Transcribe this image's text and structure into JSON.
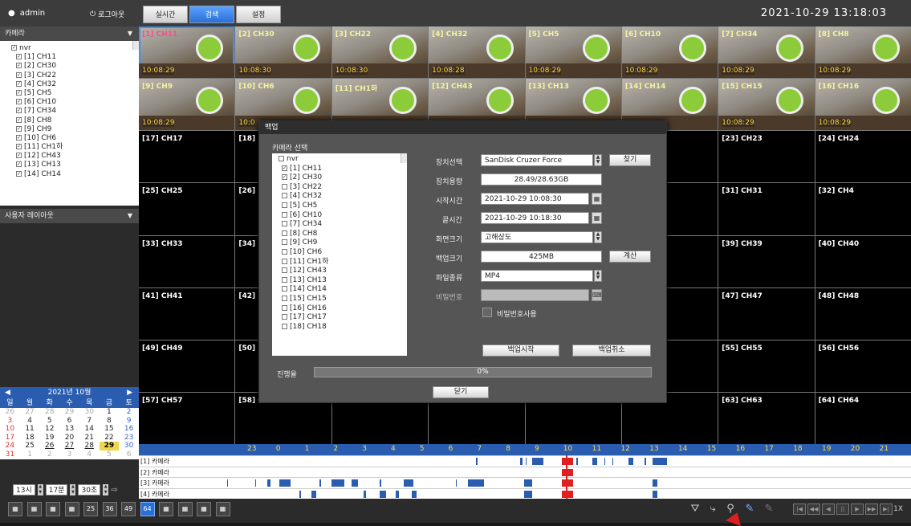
{
  "header": {
    "user": "admin",
    "logout_label": "로그아웃",
    "tabs": [
      {
        "label": "실시간",
        "active": false
      },
      {
        "label": "검색",
        "active": true
      },
      {
        "label": "설정",
        "active": false
      }
    ],
    "datetime": "2021-10-29 13:18:03"
  },
  "left_panel": {
    "camera_header": "카메라",
    "camera_root": "nvr",
    "cameras": [
      "[1] CH11",
      "[2] CH30",
      "[3] CH22",
      "[4] CH32",
      "[5] CH5",
      "[6] CH10",
      "[7] CH34",
      "[8] CH8",
      "[9] CH9",
      "[10] CH6",
      "[11] CH1하",
      "[12] CH43",
      "[13] CH13",
      "[14] CH14"
    ],
    "layout_header": "사용자 레이아웃",
    "calendar": {
      "month_label": "2021년 10월",
      "weekdays": [
        "일",
        "월",
        "화",
        "수",
        "목",
        "금",
        "토"
      ],
      "rows": [
        [
          "26",
          "27",
          "28",
          "29",
          "30",
          "1",
          "2"
        ],
        [
          "3",
          "4",
          "5",
          "6",
          "7",
          "8",
          "9"
        ],
        [
          "10",
          "11",
          "12",
          "13",
          "14",
          "15",
          "16"
        ],
        [
          "17",
          "18",
          "19",
          "20",
          "21",
          "22",
          "23"
        ],
        [
          "24",
          "25",
          "26",
          "27",
          "28",
          "29",
          "30"
        ],
        [
          "31",
          "1",
          "2",
          "3",
          "4",
          "5",
          "6"
        ]
      ],
      "selected_day": "29"
    },
    "time_controls": {
      "hour": "13시",
      "minute": "17분",
      "interval": "30초"
    }
  },
  "grid": {
    "cells": [
      {
        "label": "[1] CH11",
        "ts": "10:08:29",
        "live": true,
        "selected": true
      },
      {
        "label": "[2] CH30",
        "ts": "10:08:30",
        "live": true
      },
      {
        "label": "[3] CH22",
        "ts": "10:08:30",
        "live": true
      },
      {
        "label": "[4] CH32",
        "ts": "10:08:28",
        "live": true
      },
      {
        "label": "[5] CH5",
        "ts": "10:08:29",
        "live": true
      },
      {
        "label": "[6] CH10",
        "ts": "10:08:29",
        "live": true
      },
      {
        "label": "[7] CH34",
        "ts": "10:08:29",
        "live": true
      },
      {
        "label": "[8] CH8",
        "ts": "10:08:29",
        "live": true
      },
      {
        "label": "[9] CH9",
        "ts": "10:08:29",
        "live": true
      },
      {
        "label": "[10] CH6",
        "ts": "10:0",
        "live": true
      },
      {
        "label": "[11] CH1하",
        "ts": "",
        "live": true
      },
      {
        "label": "[12] CH43",
        "ts": "",
        "live": true
      },
      {
        "label": "[13] CH13",
        "ts": "",
        "live": true
      },
      {
        "label": "[14] CH14",
        "ts": "",
        "live": true
      },
      {
        "label": "[15] CH15",
        "ts": "10:08:29",
        "live": true
      },
      {
        "label": "[16] CH16",
        "ts": "10:08:29",
        "live": true
      },
      {
        "label": "[17] CH17"
      },
      {
        "label": "[18]"
      },
      {
        "label": ""
      },
      {
        "label": ""
      },
      {
        "label": ""
      },
      {
        "label": ""
      },
      {
        "label": "[23] CH23"
      },
      {
        "label": "[24] CH24"
      },
      {
        "label": "[25] CH25"
      },
      {
        "label": "[26]"
      },
      {
        "label": ""
      },
      {
        "label": ""
      },
      {
        "label": ""
      },
      {
        "label": ""
      },
      {
        "label": "[31] CH31"
      },
      {
        "label": "[32] CH4"
      },
      {
        "label": "[33] CH33"
      },
      {
        "label": "[34]"
      },
      {
        "label": ""
      },
      {
        "label": ""
      },
      {
        "label": ""
      },
      {
        "label": "7"
      },
      {
        "label": "[39] CH39"
      },
      {
        "label": "[40] CH40"
      },
      {
        "label": "[41] CH41"
      },
      {
        "label": "[42]"
      },
      {
        "label": ""
      },
      {
        "label": ""
      },
      {
        "label": ""
      },
      {
        "label": "5"
      },
      {
        "label": "[47] CH47"
      },
      {
        "label": "[48] CH48"
      },
      {
        "label": "[49] CH49"
      },
      {
        "label": "[50]"
      },
      {
        "label": ""
      },
      {
        "label": ""
      },
      {
        "label": ""
      },
      {
        "label": "4"
      },
      {
        "label": "[55] CH55"
      },
      {
        "label": "[56] CH56"
      },
      {
        "label": "[57] CH57"
      },
      {
        "label": "[58] CH58"
      },
      {
        "label": "[59] CH59"
      },
      {
        "label": "[60] CH60"
      },
      {
        "label": "[61] CH61"
      },
      {
        "label": "[62] CH62"
      },
      {
        "label": "[63] CH63"
      },
      {
        "label": "[64] CH64"
      }
    ]
  },
  "timeline": {
    "hours": [
      "23",
      "0",
      "1",
      "2",
      "3",
      "4",
      "5",
      "6",
      "7",
      "8",
      "9",
      "10",
      "11",
      "12",
      "13",
      "14",
      "15",
      "16",
      "17",
      "18",
      "19",
      "20",
      "21"
    ],
    "rows": [
      "[1] 카메라",
      "[2] 카메라",
      "[3] 카메라",
      "[4] 카메라"
    ]
  },
  "bottom_bar": {
    "layout_buttons": [
      "",
      "",
      "",
      "",
      "25",
      "36",
      "49",
      "64",
      "",
      "",
      "",
      ""
    ],
    "active_layout": "64",
    "speed": "1X"
  },
  "backup_dialog": {
    "title": "백업",
    "camera_select_label": "카메라 선택",
    "root": "nvr",
    "cameras": [
      {
        "label": "[1] CH11",
        "checked": true
      },
      {
        "label": "[2] CH30",
        "checked": true
      },
      {
        "label": "[3] CH22",
        "checked": false
      },
      {
        "label": "[4] CH32",
        "checked": false
      },
      {
        "label": "[5] CH5",
        "checked": false
      },
      {
        "label": "[6] CH10",
        "checked": false
      },
      {
        "label": "[7] CH34",
        "checked": false
      },
      {
        "label": "[8] CH8",
        "checked": false
      },
      {
        "label": "[9] CH9",
        "checked": false
      },
      {
        "label": "[10] CH6",
        "checked": false
      },
      {
        "label": "[11] CH1하",
        "checked": false
      },
      {
        "label": "[12] CH43",
        "checked": false
      },
      {
        "label": "[13] CH13",
        "checked": false
      },
      {
        "label": "[14] CH14",
        "checked": false
      },
      {
        "label": "[15] CH15",
        "checked": false
      },
      {
        "label": "[16] CH16",
        "checked": false
      },
      {
        "label": "[17] CH17",
        "checked": false
      },
      {
        "label": "[18] CH18",
        "checked": false
      }
    ],
    "device_select_label": "장치선택",
    "device_value": "SanDisk Cruzer Force",
    "find_button": "찾기",
    "capacity_label": "장치용량",
    "capacity_value": "28.49/28.63GB",
    "start_label": "시작시간",
    "start_value": "2021-10-29 10:08:30",
    "end_label": "끝시간",
    "end_value": "2021-10-29 10:18:30",
    "screen_size_label": "화면크기",
    "screen_size_value": "고해상도",
    "backup_size_label": "백업크기",
    "backup_size_value": "425MB",
    "calc_button": "계산",
    "file_type_label": "파일종류",
    "file_type_value": "MP4",
    "password_label": "비밀번호",
    "use_password_label": "비밀번호사용",
    "start_backup_button": "백업시작",
    "cancel_backup_button": "백업취소",
    "progress_label": "진행율",
    "progress_value": "0%",
    "close_button": "닫기"
  }
}
